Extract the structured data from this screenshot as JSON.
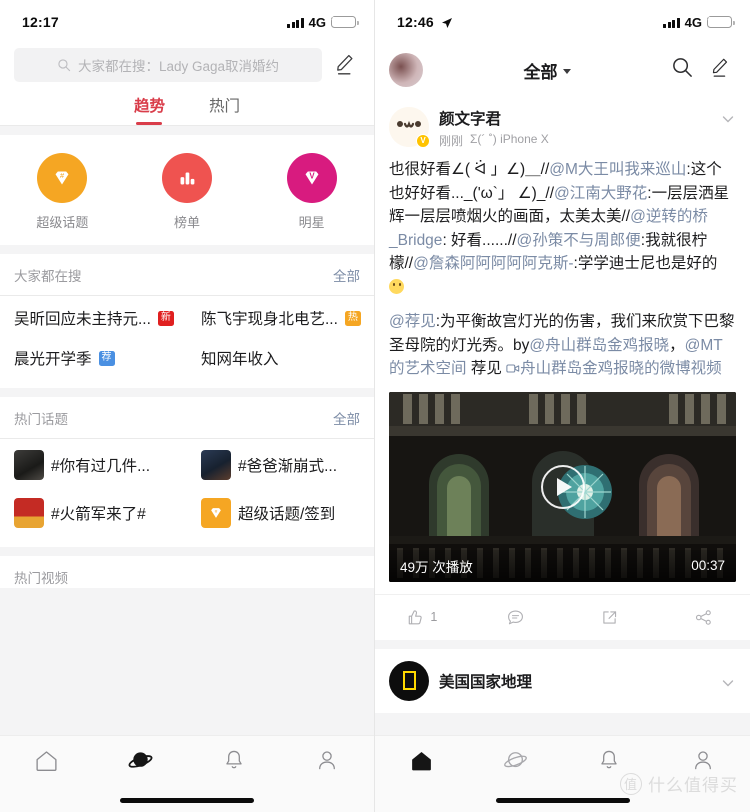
{
  "left": {
    "status": {
      "time": "12:17",
      "network": "4G",
      "icons": [
        "signal-bars-icon",
        "battery-charging-icon"
      ]
    },
    "search": {
      "placeholder": "大家都在搜：Lady Gaga取消婚约",
      "icon": "search-icon",
      "compose_icon": "pencil-icon"
    },
    "tabs": [
      {
        "label": "趋势",
        "active": true
      },
      {
        "label": "热门",
        "active": false
      }
    ],
    "categories": [
      {
        "label": "超级话题",
        "icon": "diamond-hash-icon",
        "color": "#f5a623"
      },
      {
        "label": "榜单",
        "icon": "bar-chart-icon",
        "color": "#ef5350"
      },
      {
        "label": "明星",
        "icon": "diamond-v-icon",
        "color": "#d81b7f"
      }
    ],
    "hot_search": {
      "title": "大家都在搜",
      "all": "全部",
      "items": [
        {
          "text": "吴昕回应未主持元...",
          "badge": "新",
          "badge_type": "new"
        },
        {
          "text": "陈飞宇现身北电艺...",
          "badge": "热",
          "badge_type": "hot"
        },
        {
          "text": "晨光开学季",
          "badge": "荐",
          "badge_type": "rec"
        },
        {
          "text": "知网年收入",
          "badge": "",
          "badge_type": ""
        }
      ]
    },
    "hot_topics": {
      "title": "热门话题",
      "all": "全部",
      "items": [
        {
          "text": "#你有过几件...",
          "thumb": "photo-dark-portrait"
        },
        {
          "text": "#爸爸渐崩式...",
          "thumb": "photo-blue-scene"
        },
        {
          "text": "#火箭军来了#",
          "thumb": "photo-red-emblem"
        },
        {
          "text": "超级话题/签到",
          "thumb": "diamond-orange-icon"
        }
      ]
    },
    "hot_videos": {
      "title": "热门视频"
    },
    "tabbar": [
      {
        "icon": "home-icon",
        "active": false
      },
      {
        "icon": "planet-icon",
        "active": true
      },
      {
        "icon": "bell-icon",
        "active": false
      },
      {
        "icon": "person-icon",
        "active": false
      }
    ]
  },
  "right": {
    "status": {
      "time": "12:46",
      "network": "4G",
      "icons": [
        "location-arrow-icon",
        "signal-bars-icon",
        "battery-charging-icon"
      ]
    },
    "topbar": {
      "avatar": "user-avatar",
      "title": "全部",
      "caret_icon": "chevron-down-icon",
      "search_icon": "search-icon",
      "compose_icon": "pencil-icon"
    },
    "post": {
      "avatar": "kaomoji-avatar",
      "verified_badge": "V",
      "username": "颜文字君",
      "time": "刚刚",
      "source": "Σ(´ ˚) iPhone X",
      "chevron_icon": "chevron-down-icon",
      "paragraph1_a": "也很好看∠( ᐛ 」∠)＿//",
      "paragraph1_at1": "@M大王叫我来巡山",
      "paragraph1_b": ":这个也好好看..._('ω`」 ∠)_//",
      "paragraph1_at2": "@江南大野花",
      "paragraph1_c": ":一层层洒星辉一层层喷烟火的画面，太美太美//",
      "paragraph1_at3": "@逆转的桥_Bridge",
      "paragraph1_d": ": 好看......//",
      "paragraph1_at4": "@孙策不与周郎便",
      "paragraph1_e": ":我就很柠檬//",
      "paragraph1_at5": "@詹森阿阿阿阿阿克斯-",
      "paragraph1_f": ":学学迪士尼也是好的",
      "paragraph2_at1": "@荐见",
      "paragraph2_a": ":为平衡故宫灯光的伤害，我们来欣赏下巴黎圣母院的灯光秀。by",
      "paragraph2_at2": "@舟山群岛金鸡报晓",
      "paragraph2_b": "，",
      "paragraph2_at3": "@MT的艺术空间",
      "paragraph2_c": " 荐见 ",
      "paragraph2_video_link": "舟山群岛金鸡报晓的微博视频",
      "video": {
        "thumbnail": "notre-dame-light-show",
        "play_icon": "play-icon",
        "plays": "49万 次播放",
        "duration": "00:37"
      },
      "actions": [
        {
          "icon": "thumbs-up-icon",
          "label": "1"
        },
        {
          "icon": "comment-icon",
          "label": ""
        },
        {
          "icon": "repost-icon",
          "label": ""
        },
        {
          "icon": "share-icon",
          "label": ""
        }
      ]
    },
    "next_post": {
      "avatar": "natgeo-logo",
      "username": "美国国家地理",
      "chevron_icon": "chevron-down-icon"
    },
    "tabbar": [
      {
        "icon": "home-icon",
        "active": true
      },
      {
        "icon": "planet-icon",
        "active": false
      },
      {
        "icon": "bell-icon",
        "active": false
      },
      {
        "icon": "person-icon",
        "active": false
      }
    ],
    "watermark": {
      "mark": "值",
      "text": "什么值得买"
    }
  }
}
